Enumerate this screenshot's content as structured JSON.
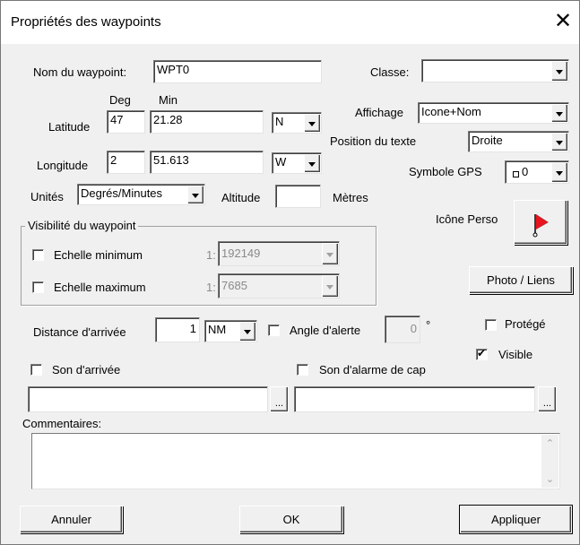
{
  "dialog": {
    "title": "Propriétés des waypoints",
    "close_glyph": "✕"
  },
  "name": {
    "label": "Nom du waypoint:",
    "value": "WPT0"
  },
  "coords": {
    "deg_header": "Deg",
    "min_header": "Min",
    "latitude": {
      "label": "Latitude",
      "deg": "47",
      "min": "21.28",
      "hemi": "N"
    },
    "longitude": {
      "label": "Longitude",
      "deg": "2",
      "min": "51.613",
      "hemi": "W"
    }
  },
  "units": {
    "label": "Unités",
    "value": "Degrés/Minutes"
  },
  "altitude": {
    "label": "Altitude",
    "value": "",
    "unit": "Mètres"
  },
  "classe": {
    "label": "Classe:",
    "value": ""
  },
  "affichage": {
    "label": "Affichage",
    "value": "Icone+Nom"
  },
  "position_texte": {
    "label": "Position du texte",
    "value": "Droite"
  },
  "symbole_gps": {
    "label": "Symbole GPS",
    "value": "0",
    "icon": "small-square-icon"
  },
  "icone_perso": {
    "label": "Icône Perso",
    "icon": "red-flag-icon",
    "flag_color": "#e8141e"
  },
  "visibility": {
    "title": "Visibilité du waypoint",
    "min": {
      "label": "Echelle minimum",
      "prefix": "1:",
      "value": "192149",
      "checked": false
    },
    "max": {
      "label": "Echelle maximum",
      "prefix": "1:",
      "value": "7685",
      "checked": false
    }
  },
  "photo_button": "Photo / Liens",
  "arrival": {
    "label": "Distance d'arrivée",
    "value": "1",
    "unit": "NM"
  },
  "alert_angle": {
    "label": "Angle d'alerte",
    "value": "0",
    "unit": "°",
    "checked": false
  },
  "protege": {
    "label": "Protégé",
    "checked": false
  },
  "visible": {
    "label": "Visible",
    "checked": true
  },
  "son_arrivee": {
    "label": "Son d'arrivée",
    "checked": false,
    "value": "",
    "browse": "..."
  },
  "son_cap": {
    "label": "Son d'alarme de cap",
    "checked": false,
    "value": "",
    "browse": "..."
  },
  "comments": {
    "label": "Commentaires:",
    "value": ""
  },
  "buttons": {
    "cancel": "Annuler",
    "ok": "OK",
    "apply": "Appliquer"
  }
}
